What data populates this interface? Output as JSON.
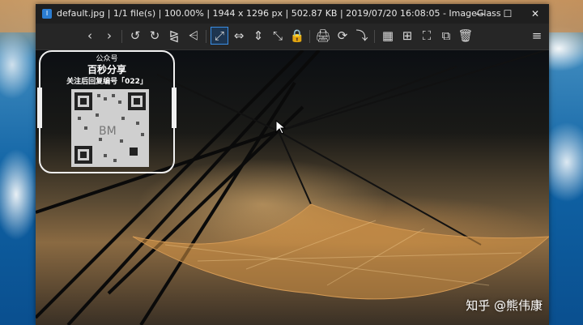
{
  "window": {
    "title": "default.jpg  |  1/1 file(s)  |  100.00%  |  1944 x 1296 px  |  502.87 KB  |  2019/07/20 16:08:05  - ImageGlass",
    "minimize": "—",
    "maximize": "☐",
    "close": "✕"
  },
  "toolbar": {
    "prev": "‹",
    "next": "›",
    "rotate_left": "↺",
    "rotate_right": "↻",
    "flip_h": "⧎",
    "flip_v": "⩤",
    "auto_zoom": "⤢",
    "scale_width": "⇔",
    "scale_height": "⇕",
    "scale_fit": "⤡",
    "lock_zoom": "🔒",
    "print_icon": "🖨",
    "refresh": "⟳",
    "goto": "⤵",
    "gallery": "▦",
    "thumbnails": "⊞",
    "slideshow": "⛶",
    "full_screen": "⧉",
    "delete": "🗑",
    "menu": "≡"
  },
  "overlay": {
    "line1": "公众号",
    "line2": "百秒分享",
    "line3": "关注后回复编号「022」"
  },
  "watermark": "知乎 @熊伟康"
}
